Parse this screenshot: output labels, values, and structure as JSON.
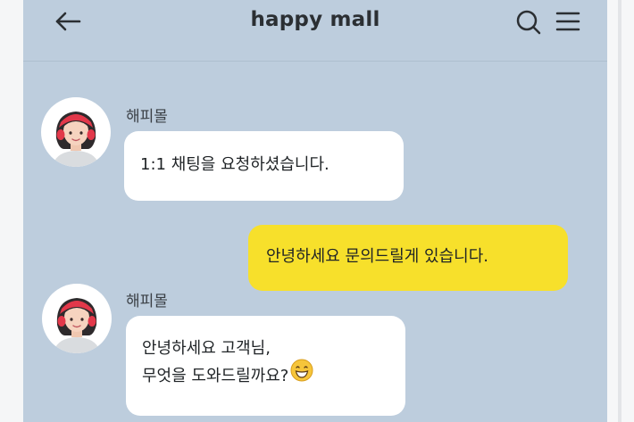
{
  "header": {
    "title": "happy mall",
    "back_icon": "arrow-left-icon",
    "search_icon": "search-icon",
    "menu_icon": "menu-icon"
  },
  "messages": [
    {
      "sender": "해피몰",
      "text": "1:1 채팅을 요청하셨습니다.",
      "from": "store"
    },
    {
      "text": "안녕하세요 문의드릴게 있습니다.",
      "from": "user"
    },
    {
      "sender": "해피몰",
      "lines": [
        "안녕하세요 고객님,",
        "무엇을 도와드릴까요?"
      ],
      "emoji": "grinning-face-icon",
      "from": "store"
    }
  ],
  "colors": {
    "background": "#bdcddd",
    "user_bubble": "#f7e02b",
    "store_bubble": "#ffffff"
  }
}
